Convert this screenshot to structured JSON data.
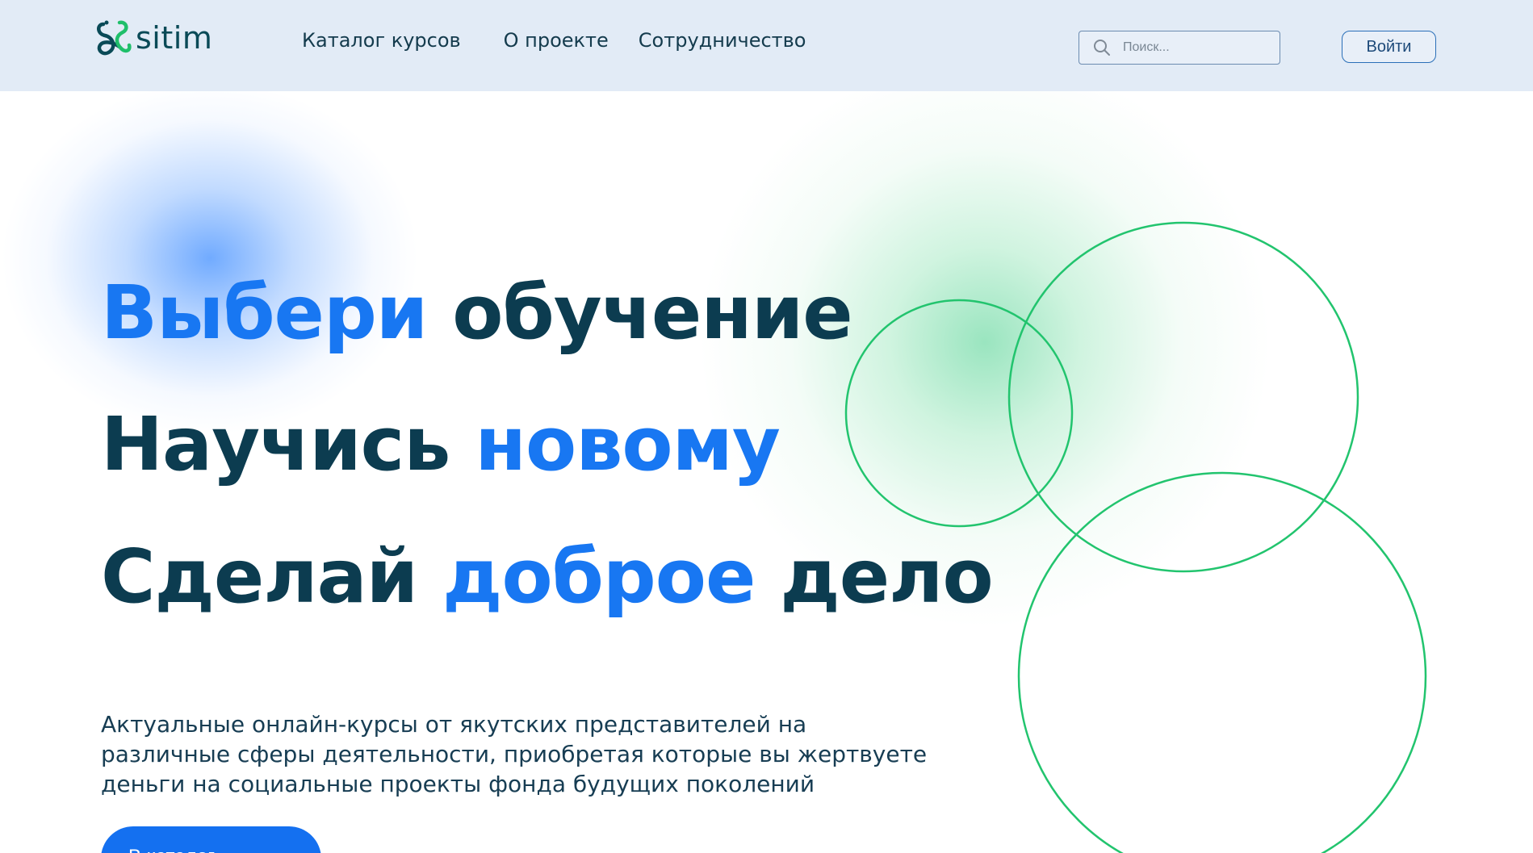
{
  "header": {
    "logo_text": "sitim",
    "nav": [
      {
        "label": "Каталог курсов"
      },
      {
        "label": "О проекте"
      },
      {
        "label": "Сотрудничество"
      }
    ],
    "search": {
      "placeholder": "Поиск..."
    },
    "login_label": "Войти"
  },
  "hero": {
    "line1": {
      "accent": "Выбери",
      "rest": " обучение"
    },
    "line2": {
      "plain": "Научись ",
      "accent": "новому"
    },
    "line3": {
      "plain": "Сделай ",
      "accent": "доброе",
      "rest": " дело"
    },
    "subtitle": "Актуальные онлайн-курсы от якутских представителей на различные сферы деятельности, приобретая которые вы жертвуете деньги на социальные проекты фонда будущих поколений",
    "cta_label": "В каталог",
    "cta_icon": "chevron-right-icon"
  },
  "colors": {
    "accent_blue": "#1877f2",
    "dark_text": "#0c3c50",
    "header_bg": "#e2ebf6",
    "circle_green": "#22c46e"
  }
}
